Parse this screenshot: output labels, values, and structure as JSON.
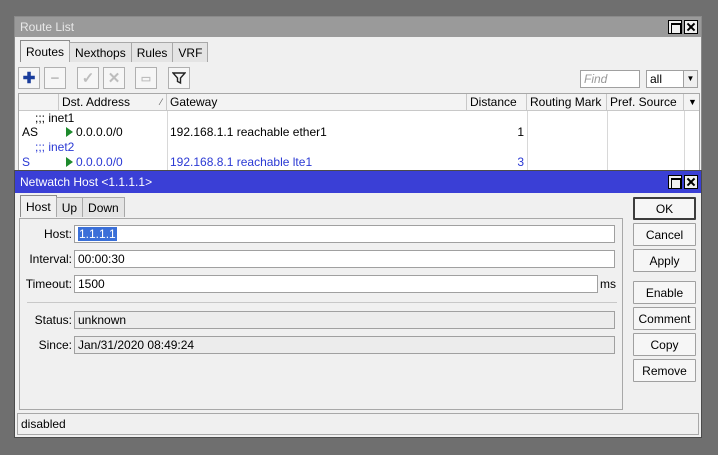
{
  "route_list": {
    "title": "Route List",
    "tabs": [
      "Routes",
      "Nexthops",
      "Rules",
      "VRF"
    ],
    "find_placeholder": "Find",
    "filter_value": "all",
    "columns": [
      "Dst. Address",
      "Gateway",
      "Distance",
      "Routing Mark",
      "Pref. Source"
    ],
    "rows": [
      {
        "comment": ";;; inet1"
      },
      {
        "flags": "AS",
        "dst": "0.0.0.0/0",
        "gateway": "192.168.1.1 reachable ether1",
        "distance": "1"
      },
      {
        "comment": ";;; inet2"
      },
      {
        "flags": "S",
        "dst": "0.0.0.0/0",
        "gateway": "192.168.8.1 reachable lte1",
        "distance": "3"
      }
    ]
  },
  "netwatch": {
    "title": "Netwatch Host <1.1.1.1>",
    "tabs": [
      "Host",
      "Up",
      "Down"
    ],
    "fields": {
      "host": {
        "label": "Host:",
        "value": "1.1.1.1"
      },
      "interval": {
        "label": "Interval:",
        "value": "00:00:30"
      },
      "timeout": {
        "label": "Timeout:",
        "value": "1500",
        "unit": "ms"
      },
      "status": {
        "label": "Status:",
        "value": "unknown"
      },
      "since": {
        "label": "Since:",
        "value": "Jan/31/2020 08:49:24"
      }
    },
    "buttons": [
      "OK",
      "Cancel",
      "Apply",
      "Enable",
      "Comment",
      "Copy",
      "Remove"
    ],
    "status_bar": "disabled"
  },
  "colors": {
    "active_title": "#3a3fd6",
    "inactive_title": "#9a9a9a",
    "static_route_text": "#2a39d4",
    "route_flag": "#1d8a2c"
  },
  "icons": [
    "add-icon",
    "remove-icon",
    "enable-icon",
    "disable-icon",
    "comment-icon",
    "filter-icon",
    "maximize-icon",
    "close-icon",
    "sort-icon",
    "column-dropdown-icon",
    "active-route-flag-icon"
  ]
}
